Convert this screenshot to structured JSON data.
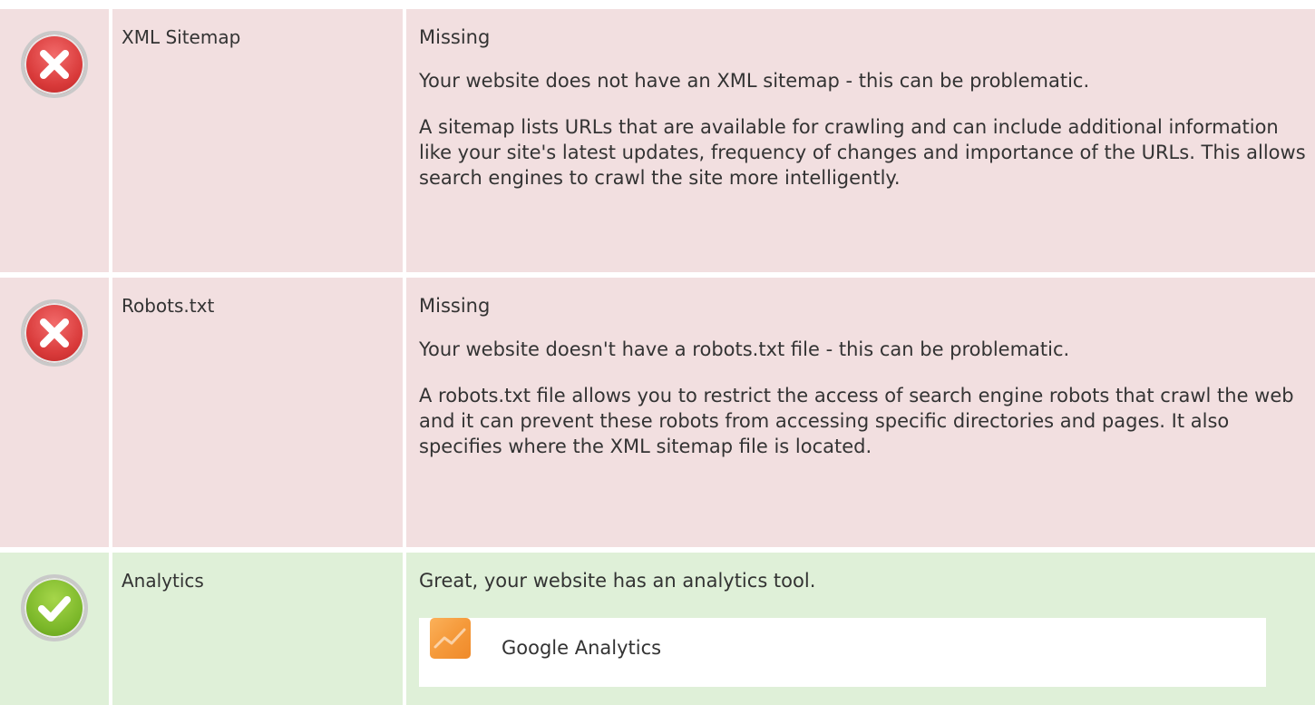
{
  "checks": [
    {
      "status": "fail",
      "status_icon": "error-x-icon",
      "label": "XML Sitemap",
      "result": "Missing",
      "paragraphs": [
        "Your website does not have an XML sitemap - this can be problematic.",
        "A sitemap lists URLs that are available for crawling and can include additional information like your site's latest updates, frequency of changes and importance of the URLs. This allows search engines to crawl the site more intelligently."
      ]
    },
    {
      "status": "fail",
      "status_icon": "error-x-icon",
      "label": "Robots.txt",
      "result": "Missing",
      "paragraphs": [
        "Your website doesn't have a robots.txt file - this can be problematic.",
        "A robots.txt file allows you to restrict the access of search engine robots that crawl the web and it can prevent these robots from accessing specific directories and pages. It also specifies where the XML sitemap file is located."
      ]
    },
    {
      "status": "pass",
      "status_icon": "success-check-icon",
      "label": "Analytics",
      "result": "Great, your website has an analytics tool.",
      "tool": {
        "icon": "google-analytics-logo-icon",
        "name": "Google Analytics"
      }
    }
  ],
  "colors": {
    "fail_bg": "#f2dfe0",
    "pass_bg": "#dff0d8",
    "fail_icon": "#d93a3a",
    "pass_icon": "#7cb82a",
    "analytics_logo": "#f59a3b"
  }
}
